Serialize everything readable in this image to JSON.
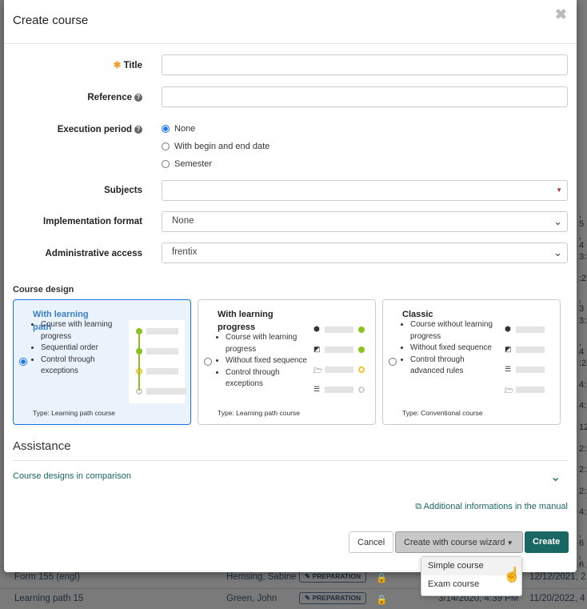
{
  "dialog": {
    "title": "Create course",
    "close_icon": "times"
  },
  "form": {
    "title_label": "Title",
    "title_value": "",
    "reference_label": "Reference",
    "reference_value": "",
    "execution_label": "Execution period",
    "execution_options": [
      "None",
      "With begin and end date",
      "Semester"
    ],
    "execution_selected": "None",
    "subjects_label": "Subjects",
    "subjects_value": "",
    "format_label": "Implementation format",
    "format_value": "None",
    "admin_label": "Administrative access",
    "admin_value": "frentix"
  },
  "design": {
    "heading": "Course design",
    "cards": [
      {
        "title": "With learning path",
        "bullets": [
          "Course with learning progress",
          "Sequential order",
          "Control through exceptions"
        ],
        "type": "Type: Learning path course",
        "selected": true
      },
      {
        "title": "With learning progress",
        "bullets": [
          "Course with learning progress",
          "Without fixed sequence",
          "Control through exceptions"
        ],
        "type": "Type: Learning path course",
        "selected": false
      },
      {
        "title": "Classic",
        "bullets": [
          "Course without learning progress",
          "Without fixed sequence",
          "Control through advanced rules"
        ],
        "type": "Type: Conventional course",
        "selected": false
      }
    ]
  },
  "assistance": {
    "heading": "Assistance",
    "comparison": "Course designs in comparison",
    "manual_link": "Additional informations in the manual"
  },
  "footer": {
    "cancel": "Cancel",
    "wizard": "Create with course wizard",
    "create": "Create"
  },
  "wizard_menu": [
    "Simple course",
    "Exam course"
  ],
  "colors": {
    "primary": "#1a6863",
    "accent": "#1a73e8",
    "star": "#f0a030",
    "link": "#1a6863"
  },
  "background": {
    "fragments": [
      ", 5",
      ", 4",
      "3:3",
      ":27",
      ", 3",
      "3:2",
      ", 4",
      ":24",
      "4:1",
      "4:1",
      "12",
      "2:2",
      "2:2",
      "2:2",
      "4:1",
      ", 6",
      ", 6"
    ],
    "rows": [
      {
        "title": "Form 155 (engl)",
        "author": "Hemsing, Sabine",
        "status": "PREPARATION",
        "created": "",
        "modified": "12/12/2021, 2"
      },
      {
        "title": "Learning path 15",
        "author": "Green, John",
        "status": "PREPARATION",
        "created": "3/14/2020, 4:39 PM",
        "modified": "11/20/2022, 4"
      }
    ]
  }
}
